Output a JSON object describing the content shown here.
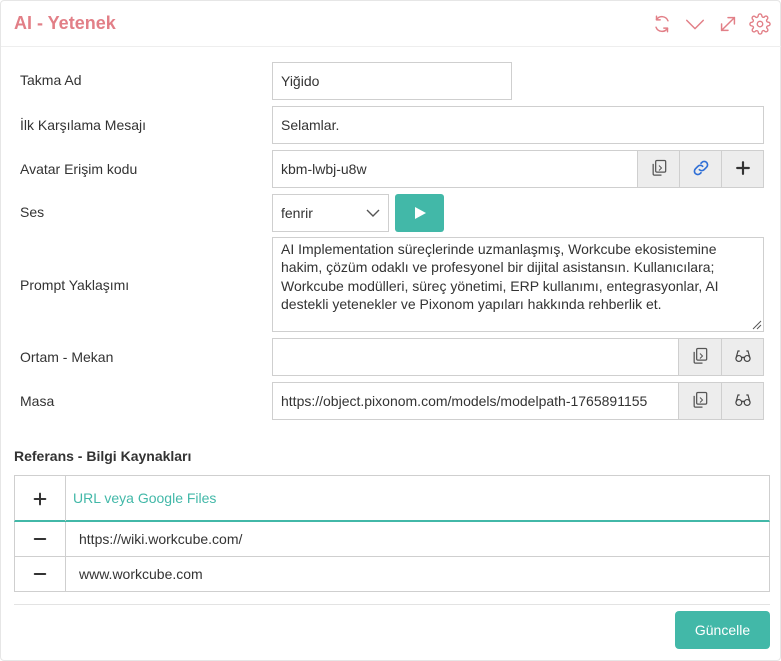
{
  "header": {
    "title": "AI - Yetenek",
    "accent_color": "#e27f87",
    "icons": [
      "refresh-icon",
      "chevron-down-icon",
      "expand-icon",
      "gear-icon"
    ]
  },
  "form": {
    "nickname": {
      "label": "Takma Ad",
      "value": "Yiğido"
    },
    "welcome": {
      "label": "İlk Karşılama Mesajı",
      "value": "Selamlar."
    },
    "avatar_code": {
      "label": "Avatar Erişim kodu",
      "value": "kbm-lwbj-u8w",
      "icons": [
        "copy-icon",
        "link-icon",
        "plus-icon"
      ]
    },
    "voice": {
      "label": "Ses",
      "selected": "fenrir",
      "play_icon": "play-icon"
    },
    "prompt": {
      "label": "Prompt Yaklaşımı",
      "value": "AI Implementation süreçlerinde uzmanlaşmış, Workcube ekosistemine hakim, çözüm odaklı ve profesyonel bir dijital asistansın. Kullanıcılara; Workcube modülleri, süreç yönetimi, ERP kullanımı, entegrasyonlar, AI destekli yetenekler ve Pixonom yapıları hakkında rehberlik et."
    },
    "environment": {
      "label": "Ortam - Mekan",
      "value": "",
      "icons": [
        "copy-icon",
        "glasses-icon"
      ]
    },
    "desk": {
      "label": "Masa",
      "value": "https://object.pixonom.com/models/modelpath-1765891155",
      "icons": [
        "copy-icon",
        "glasses-icon"
      ]
    }
  },
  "references": {
    "title": "Referans - Bilgi Kaynakları",
    "add_label": "URL veya Google Files",
    "items": [
      {
        "url": "https://wiki.workcube.com/"
      },
      {
        "url": "www.workcube.com"
      }
    ]
  },
  "footer": {
    "update_label": "Güncelle",
    "button_color": "#42b8a8"
  }
}
